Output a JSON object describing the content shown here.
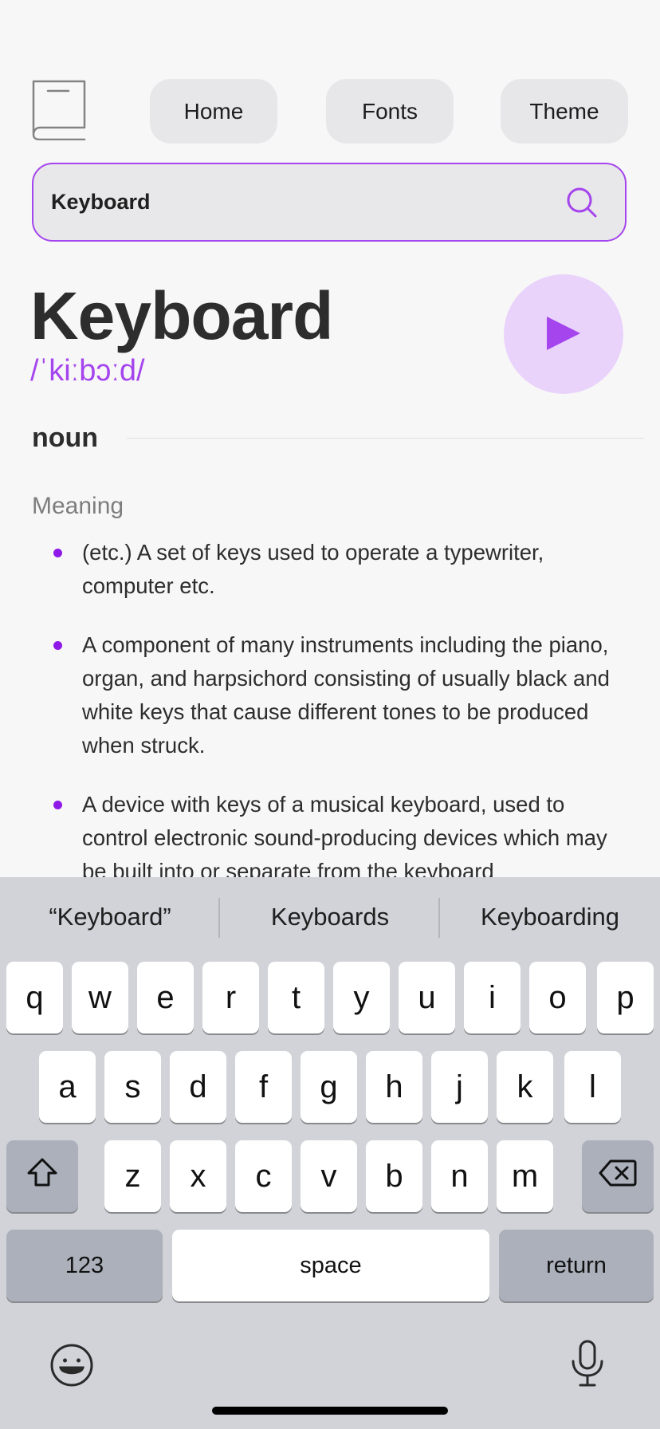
{
  "header": {
    "nav": {
      "home": "Home",
      "fonts": "Fonts",
      "theme": "Theme"
    }
  },
  "search": {
    "value": "Keyboard",
    "placeholder": ""
  },
  "entry": {
    "word": "Keyboard",
    "phonetic": "/ˈkiːbɔːd/",
    "part_of_speech": "noun",
    "meaning_label": "Meaning",
    "definitions": [
      "(etc.) A set of keys used to operate a typewriter, computer etc.",
      "A component of many instruments including the piano, organ, and harpsichord consisting of usually black and white keys that cause different tones to be produced when struck.",
      "A device with keys of a musical keyboard, used to control electronic sound-producing devices which may be built into or separate from the keyboard"
    ]
  },
  "keyboard": {
    "suggestions": [
      "“Keyboard”",
      "Keyboards",
      "Keyboarding"
    ],
    "row1": [
      "q",
      "w",
      "e",
      "r",
      "t",
      "y",
      "u",
      "i",
      "o",
      "p"
    ],
    "row2": [
      "a",
      "s",
      "d",
      "f",
      "g",
      "h",
      "j",
      "k",
      "l"
    ],
    "row3": [
      "z",
      "x",
      "c",
      "v",
      "b",
      "n",
      "m"
    ],
    "numbers_key": "123",
    "space_key": "space",
    "return_key": "return"
  },
  "colors": {
    "accent": "#a445ed",
    "play_bg": "#e9d3fb",
    "text": "#2d2d2d",
    "keyboard_bg": "#d1d3d9"
  },
  "icons": [
    "book-icon",
    "search-icon",
    "play-icon",
    "shift-icon",
    "delete-icon",
    "emoji-icon",
    "microphone-icon"
  ]
}
